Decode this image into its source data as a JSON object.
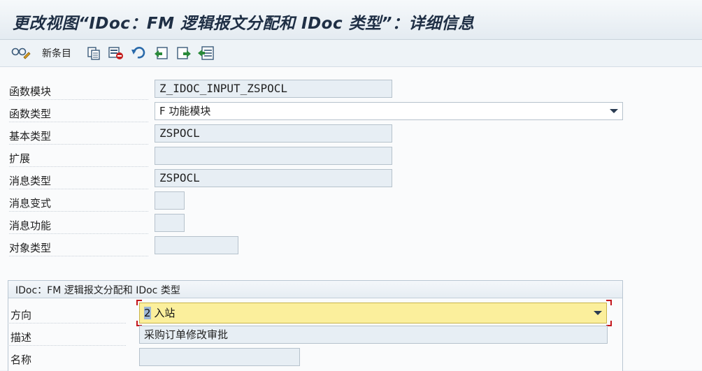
{
  "window": {
    "title": "更改视图“IDoc：FM 逻辑报文分配和 IDoc 类型”：详细信息"
  },
  "toolbar": {
    "new_entries_label": "新条目",
    "icons": [
      "display-change-icon",
      "copy-icon",
      "delete-icon",
      "undo-icon",
      "previous-entry-icon",
      "next-entry-icon",
      "select-block-icon"
    ]
  },
  "form": {
    "function_module": {
      "label": "函数模块",
      "value": "Z_IDOC_INPUT_ZSPOCL"
    },
    "function_type": {
      "label": "函数类型",
      "value": "F 功能模块"
    },
    "basic_type": {
      "label": "基本类型",
      "value": "ZSPOCL"
    },
    "extension": {
      "label": "扩展",
      "value": ""
    },
    "message_type": {
      "label": "消息类型",
      "value": "ZSPOCL"
    },
    "message_variant": {
      "label": "消息变式",
      "value": ""
    },
    "message_function": {
      "label": "消息功能",
      "value": ""
    },
    "object_type": {
      "label": "对象类型",
      "value": ""
    }
  },
  "group": {
    "title": "IDoc：FM 逻辑报文分配和 IDoc 类型",
    "direction": {
      "label": "方向",
      "value_code": "2",
      "value_text": "入站"
    },
    "description": {
      "label": "描述",
      "value": "采购订单修改审批"
    },
    "name": {
      "label": "名称",
      "value": ""
    }
  },
  "colors": {
    "title_text": "#1f2f45",
    "focus_field": "#fbef9c",
    "focus_bracket": "#c4161c",
    "field_bg": "#e7eef4"
  }
}
